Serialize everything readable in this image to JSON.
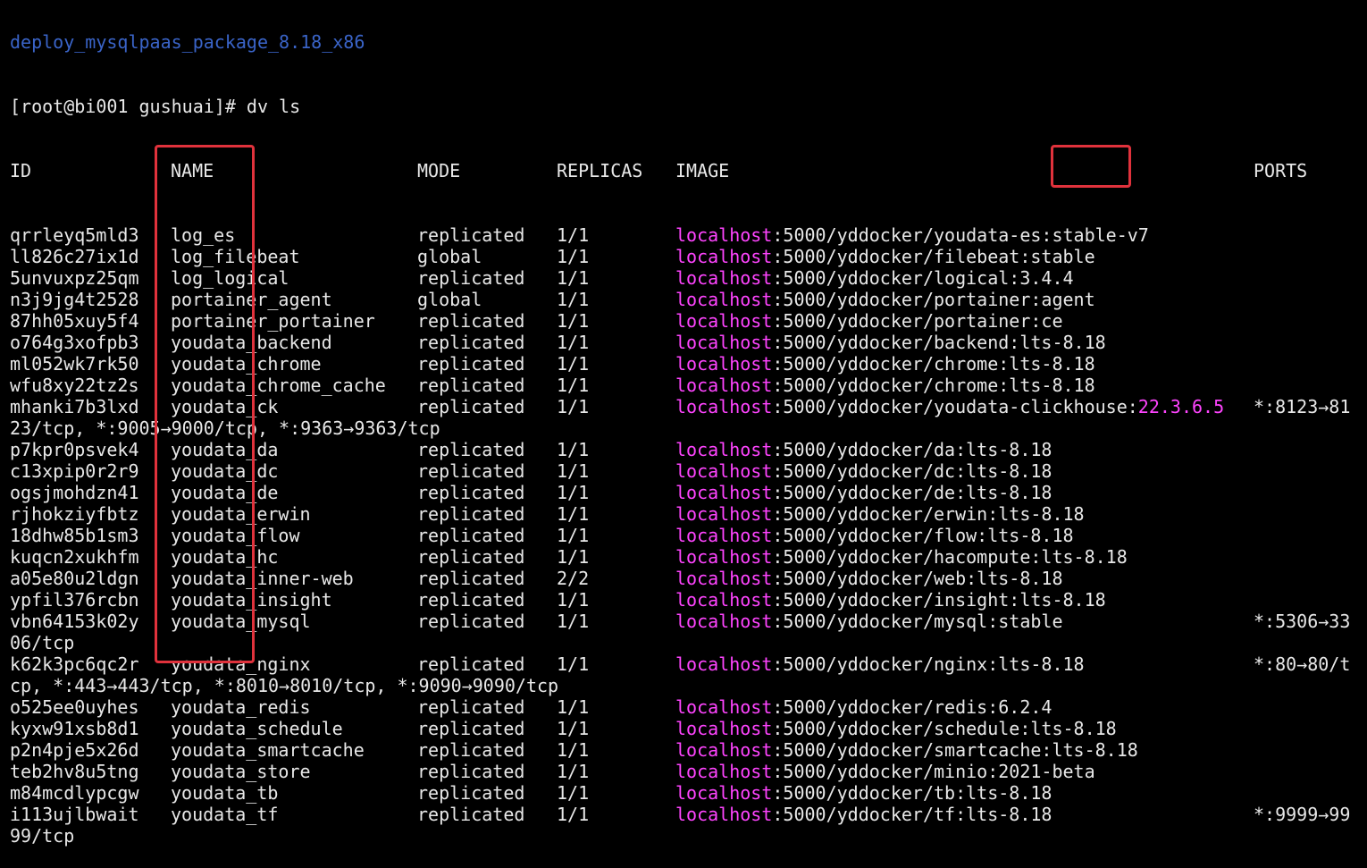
{
  "terminal": {
    "partial_top_line": "deploy_mysqlpaas_package_8.18_x86",
    "prompt": "[root@bi001 gushuai]# dv ls",
    "headers": {
      "id": "ID",
      "name": "NAME",
      "mode": "MODE",
      "replicas": "REPLICAS",
      "image": "IMAGE",
      "ports": "PORTS"
    },
    "rows": [
      {
        "id": "qrrleyq5mld3",
        "name": "log_es",
        "mode": "replicated",
        "replicas": "1/1",
        "image_host": "localhost",
        "image_rest": ":5000/yddocker/youdata-es:stable-v7",
        "image_tag_highlight": "",
        "ports": "",
        "wrap": ""
      },
      {
        "id": "ll826c27ix1d",
        "name": "log_filebeat",
        "mode": "global",
        "replicas": "1/1",
        "image_host": "localhost",
        "image_rest": ":5000/yddocker/filebeat:stable",
        "image_tag_highlight": "",
        "ports": "",
        "wrap": ""
      },
      {
        "id": "5unvuxpz25qm",
        "name": "log_logical",
        "mode": "replicated",
        "replicas": "1/1",
        "image_host": "localhost",
        "image_rest": ":5000/yddocker/logical:3.4.4",
        "image_tag_highlight": "",
        "ports": "",
        "wrap": ""
      },
      {
        "id": "n3j9jg4t2528",
        "name": "portainer_agent",
        "mode": "global",
        "replicas": "1/1",
        "image_host": "localhost",
        "image_rest": ":5000/yddocker/portainer:agent",
        "image_tag_highlight": "",
        "ports": "",
        "wrap": ""
      },
      {
        "id": "87hh05xuy5f4",
        "name": "portainer_portainer",
        "mode": "replicated",
        "replicas": "1/1",
        "image_host": "localhost",
        "image_rest": ":5000/yddocker/portainer:ce",
        "image_tag_highlight": "",
        "ports": "",
        "wrap": ""
      },
      {
        "id": "o764g3xofpb3",
        "name": "youdata_backend",
        "mode": "replicated",
        "replicas": "1/1",
        "image_host": "localhost",
        "image_rest": ":5000/yddocker/backend:lts-8.18",
        "image_tag_highlight": "",
        "ports": "",
        "wrap": ""
      },
      {
        "id": "ml052wk7rk50",
        "name": "youdata_chrome",
        "mode": "replicated",
        "replicas": "1/1",
        "image_host": "localhost",
        "image_rest": ":5000/yddocker/chrome:lts-8.18",
        "image_tag_highlight": "",
        "ports": "",
        "wrap": ""
      },
      {
        "id": "wfu8xy22tz2s",
        "name": "youdata_chrome_cache",
        "mode": "replicated",
        "replicas": "1/1",
        "image_host": "localhost",
        "image_rest": ":5000/yddocker/chrome:lts-8.18",
        "image_tag_highlight": "",
        "ports": "",
        "wrap": ""
      },
      {
        "id": "mhanki7b3lxd",
        "name": "youdata_ck",
        "mode": "replicated",
        "replicas": "1/1",
        "image_host": "localhost",
        "image_rest": ":5000/yddocker/youdata-clickhouse:",
        "image_tag_highlight": "22.3.6.5",
        "ports": "*:8123→81",
        "wrap": "23/tcp, *:9005→9000/tcp, *:9363→9363/tcp"
      },
      {
        "id": "p7kpr0psvek4",
        "name": "youdata_da",
        "mode": "replicated",
        "replicas": "1/1",
        "image_host": "localhost",
        "image_rest": ":5000/yddocker/da:lts-8.18",
        "image_tag_highlight": "",
        "ports": "",
        "wrap": ""
      },
      {
        "id": "c13xpip0r2r9",
        "name": "youdata_dc",
        "mode": "replicated",
        "replicas": "1/1",
        "image_host": "localhost",
        "image_rest": ":5000/yddocker/dc:lts-8.18",
        "image_tag_highlight": "",
        "ports": "",
        "wrap": ""
      },
      {
        "id": "ogsjmohdzn41",
        "name": "youdata_de",
        "mode": "replicated",
        "replicas": "1/1",
        "image_host": "localhost",
        "image_rest": ":5000/yddocker/de:lts-8.18",
        "image_tag_highlight": "",
        "ports": "",
        "wrap": ""
      },
      {
        "id": "rjhokziyfbtz",
        "name": "youdata_erwin",
        "mode": "replicated",
        "replicas": "1/1",
        "image_host": "localhost",
        "image_rest": ":5000/yddocker/erwin:lts-8.18",
        "image_tag_highlight": "",
        "ports": "",
        "wrap": ""
      },
      {
        "id": "18dhw85b1sm3",
        "name": "youdata_flow",
        "mode": "replicated",
        "replicas": "1/1",
        "image_host": "localhost",
        "image_rest": ":5000/yddocker/flow:lts-8.18",
        "image_tag_highlight": "",
        "ports": "",
        "wrap": ""
      },
      {
        "id": "kuqcn2xukhfm",
        "name": "youdata_hc",
        "mode": "replicated",
        "replicas": "1/1",
        "image_host": "localhost",
        "image_rest": ":5000/yddocker/hacompute:lts-8.18",
        "image_tag_highlight": "",
        "ports": "",
        "wrap": ""
      },
      {
        "id": "a05e80u2ldgn",
        "name": "youdata_inner-web",
        "mode": "replicated",
        "replicas": "2/2",
        "image_host": "localhost",
        "image_rest": ":5000/yddocker/web:lts-8.18",
        "image_tag_highlight": "",
        "ports": "",
        "wrap": ""
      },
      {
        "id": "ypfil376rcbn",
        "name": "youdata_insight",
        "mode": "replicated",
        "replicas": "1/1",
        "image_host": "localhost",
        "image_rest": ":5000/yddocker/insight:lts-8.18",
        "image_tag_highlight": "",
        "ports": "",
        "wrap": ""
      },
      {
        "id": "vbn64153k02y",
        "name": "youdata_mysql",
        "mode": "replicated",
        "replicas": "1/1",
        "image_host": "localhost",
        "image_rest": ":5000/yddocker/mysql:stable",
        "image_tag_highlight": "",
        "ports": "*:5306→33",
        "wrap": "06/tcp"
      },
      {
        "id": "k62k3pc6qc2r",
        "name": "youdata_nginx",
        "mode": "replicated",
        "replicas": "1/1",
        "image_host": "localhost",
        "image_rest": ":5000/yddocker/nginx:lts-8.18",
        "image_tag_highlight": "",
        "ports": "*:80→80/t",
        "wrap": "cp, *:443→443/tcp, *:8010→8010/tcp, *:9090→9090/tcp"
      },
      {
        "id": "o525ee0uyhes",
        "name": "youdata_redis",
        "mode": "replicated",
        "replicas": "1/1",
        "image_host": "localhost",
        "image_rest": ":5000/yddocker/redis:6.2.4",
        "image_tag_highlight": "",
        "ports": "",
        "wrap": ""
      },
      {
        "id": "kyxw91xsb8d1",
        "name": "youdata_schedule",
        "mode": "replicated",
        "replicas": "1/1",
        "image_host": "localhost",
        "image_rest": ":5000/yddocker/schedule:lts-8.18",
        "image_tag_highlight": "",
        "ports": "",
        "wrap": ""
      },
      {
        "id": "p2n4pje5x26d",
        "name": "youdata_smartcache",
        "mode": "replicated",
        "replicas": "1/1",
        "image_host": "localhost",
        "image_rest": ":5000/yddocker/smartcache:lts-8.18",
        "image_tag_highlight": "",
        "ports": "",
        "wrap": ""
      },
      {
        "id": "teb2hv8u5tng",
        "name": "youdata_store",
        "mode": "replicated",
        "replicas": "1/1",
        "image_host": "localhost",
        "image_rest": ":5000/yddocker/minio:2021-beta",
        "image_tag_highlight": "",
        "ports": "",
        "wrap": ""
      },
      {
        "id": "m84mcdlypcgw",
        "name": "youdata_tb",
        "mode": "replicated",
        "replicas": "1/1",
        "image_host": "localhost",
        "image_rest": ":5000/yddocker/tb:lts-8.18",
        "image_tag_highlight": "",
        "ports": "",
        "wrap": ""
      },
      {
        "id": "i113ujlbwait",
        "name": "youdata_tf",
        "mode": "replicated",
        "replicas": "1/1",
        "image_host": "localhost",
        "image_rest": ":5000/yddocker/tf:lts-8.18",
        "image_tag_highlight": "",
        "ports": "*:9999→99",
        "wrap": "99/tcp"
      }
    ]
  },
  "colors": {
    "background": "#000000",
    "text": "#e8e8e8",
    "host_highlight": "#ff44ff",
    "annotation_box": "#e0323c"
  }
}
